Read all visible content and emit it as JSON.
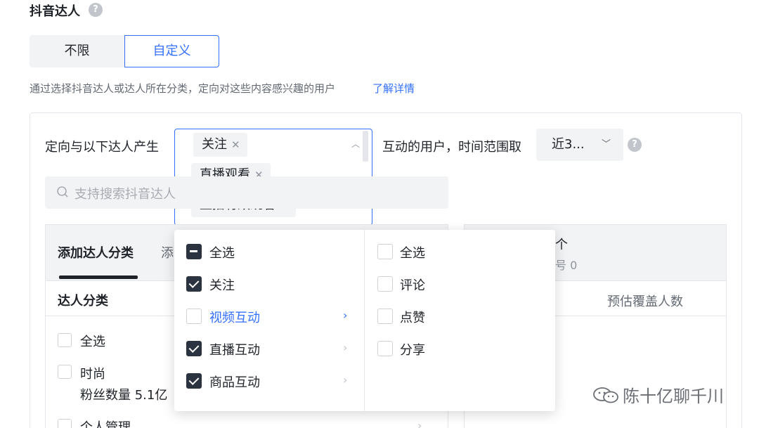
{
  "section": {
    "title": "抖音达人",
    "segments": {
      "unlimited": "不限",
      "custom": "自定义"
    },
    "description": "通过选择抖音达人或达人所在分类，定向对这些内容感兴趣的用户",
    "learn_more": "了解详情"
  },
  "targeting": {
    "prefix": "定向与以下达人产生",
    "selected_tags": [
      {
        "label": "关注"
      },
      {
        "label": "直播观看"
      },
      {
        "label": "直播有效观看"
      }
    ],
    "middle": "互动的用户，时间范围取",
    "time_range": "近3..."
  },
  "search": {
    "placeholder": "支持搜索抖音达人"
  },
  "left_panel": {
    "tab_active": "添加达人分类",
    "tab_other": "添",
    "column": "达人分类",
    "items": [
      {
        "label": "全选"
      },
      {
        "label": "时尚",
        "sub": "粉丝数量 5.1亿"
      },
      {
        "label": "个人管理"
      }
    ]
  },
  "right_panel": {
    "head1": "个",
    "head2": "号 0",
    "column": "预估覆盖人数"
  },
  "dropdown": {
    "left": [
      {
        "label": "全选",
        "state": "partial"
      },
      {
        "label": "关注",
        "state": "checked"
      },
      {
        "label": "视频互动",
        "state": "unchecked",
        "active": true
      },
      {
        "label": "直播互动",
        "state": "checked"
      },
      {
        "label": "商品互动",
        "state": "checked"
      }
    ],
    "right": [
      {
        "label": "全选"
      },
      {
        "label": "评论"
      },
      {
        "label": "点赞"
      },
      {
        "label": "分享"
      }
    ]
  },
  "watermark": "陈十亿聊千川",
  "colors": {
    "accent": "#3370ff",
    "checked": "#2b3340",
    "fill": "#f2f3f5"
  }
}
